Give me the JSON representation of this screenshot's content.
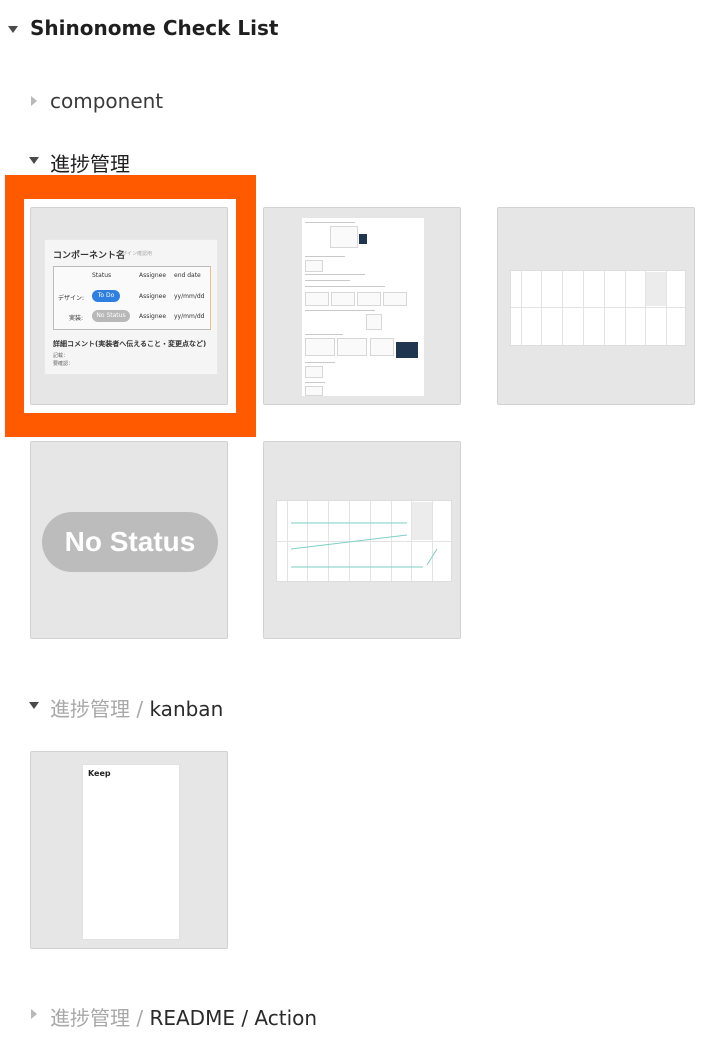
{
  "tree": {
    "root": {
      "label": "Shinonome Check List"
    },
    "component": {
      "label": "component"
    },
    "progress": {
      "label": "進捗管理"
    },
    "kanban": {
      "prefix": "進捗管理",
      "sep": " / ",
      "label": "kanban"
    },
    "readme": {
      "prefix": "進捗管理",
      "sep1": " / ",
      "mid": "README",
      "sep2": " / ",
      "label": "Action"
    }
  },
  "thumb1": {
    "title": "コンポーネント名",
    "subtitle": "デザイン確認用",
    "headers": {
      "status": "Status",
      "assignee": "Assignee",
      "end": "end date"
    },
    "rows": [
      {
        "label": "デザイン:",
        "status": "To Do",
        "assignee": "Assignee",
        "end": "yy/mm/dd"
      },
      {
        "label": "実装:",
        "status": "No Status",
        "assignee": "Assignee",
        "end": "yy/mm/dd"
      }
    ],
    "comment": "詳細コメント(実装者へ伝えること・変更点など)",
    "lines": [
      "記載：",
      "要確認："
    ]
  },
  "thumb4": {
    "pill": "No Status"
  },
  "thumb6": {
    "heading": "Keep"
  },
  "colors": {
    "selection": "#ff5a00",
    "todo": "#2f7fe0",
    "nostatus": "#bcbcbc"
  },
  "icons": [
    "caret-down-icon",
    "caret-right-icon"
  ]
}
